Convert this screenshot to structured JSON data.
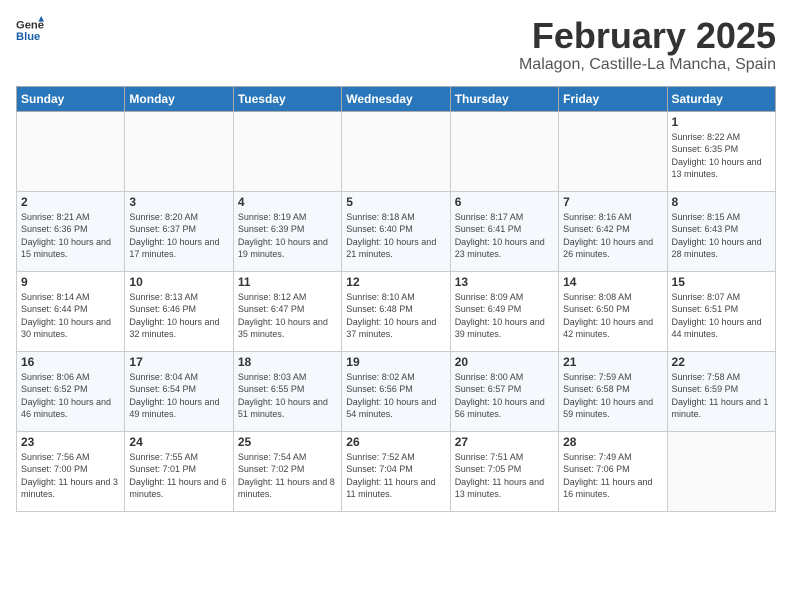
{
  "header": {
    "logo_line1": "General",
    "logo_line2": "Blue",
    "month_title": "February 2025",
    "location": "Malagon, Castille-La Mancha, Spain"
  },
  "weekdays": [
    "Sunday",
    "Monday",
    "Tuesday",
    "Wednesday",
    "Thursday",
    "Friday",
    "Saturday"
  ],
  "weeks": [
    [
      {
        "day": "",
        "info": ""
      },
      {
        "day": "",
        "info": ""
      },
      {
        "day": "",
        "info": ""
      },
      {
        "day": "",
        "info": ""
      },
      {
        "day": "",
        "info": ""
      },
      {
        "day": "",
        "info": ""
      },
      {
        "day": "1",
        "info": "Sunrise: 8:22 AM\nSunset: 6:35 PM\nDaylight: 10 hours and 13 minutes."
      }
    ],
    [
      {
        "day": "2",
        "info": "Sunrise: 8:21 AM\nSunset: 6:36 PM\nDaylight: 10 hours and 15 minutes."
      },
      {
        "day": "3",
        "info": "Sunrise: 8:20 AM\nSunset: 6:37 PM\nDaylight: 10 hours and 17 minutes."
      },
      {
        "day": "4",
        "info": "Sunrise: 8:19 AM\nSunset: 6:39 PM\nDaylight: 10 hours and 19 minutes."
      },
      {
        "day": "5",
        "info": "Sunrise: 8:18 AM\nSunset: 6:40 PM\nDaylight: 10 hours and 21 minutes."
      },
      {
        "day": "6",
        "info": "Sunrise: 8:17 AM\nSunset: 6:41 PM\nDaylight: 10 hours and 23 minutes."
      },
      {
        "day": "7",
        "info": "Sunrise: 8:16 AM\nSunset: 6:42 PM\nDaylight: 10 hours and 26 minutes."
      },
      {
        "day": "8",
        "info": "Sunrise: 8:15 AM\nSunset: 6:43 PM\nDaylight: 10 hours and 28 minutes."
      }
    ],
    [
      {
        "day": "9",
        "info": "Sunrise: 8:14 AM\nSunset: 6:44 PM\nDaylight: 10 hours and 30 minutes."
      },
      {
        "day": "10",
        "info": "Sunrise: 8:13 AM\nSunset: 6:46 PM\nDaylight: 10 hours and 32 minutes."
      },
      {
        "day": "11",
        "info": "Sunrise: 8:12 AM\nSunset: 6:47 PM\nDaylight: 10 hours and 35 minutes."
      },
      {
        "day": "12",
        "info": "Sunrise: 8:10 AM\nSunset: 6:48 PM\nDaylight: 10 hours and 37 minutes."
      },
      {
        "day": "13",
        "info": "Sunrise: 8:09 AM\nSunset: 6:49 PM\nDaylight: 10 hours and 39 minutes."
      },
      {
        "day": "14",
        "info": "Sunrise: 8:08 AM\nSunset: 6:50 PM\nDaylight: 10 hours and 42 minutes."
      },
      {
        "day": "15",
        "info": "Sunrise: 8:07 AM\nSunset: 6:51 PM\nDaylight: 10 hours and 44 minutes."
      }
    ],
    [
      {
        "day": "16",
        "info": "Sunrise: 8:06 AM\nSunset: 6:52 PM\nDaylight: 10 hours and 46 minutes."
      },
      {
        "day": "17",
        "info": "Sunrise: 8:04 AM\nSunset: 6:54 PM\nDaylight: 10 hours and 49 minutes."
      },
      {
        "day": "18",
        "info": "Sunrise: 8:03 AM\nSunset: 6:55 PM\nDaylight: 10 hours and 51 minutes."
      },
      {
        "day": "19",
        "info": "Sunrise: 8:02 AM\nSunset: 6:56 PM\nDaylight: 10 hours and 54 minutes."
      },
      {
        "day": "20",
        "info": "Sunrise: 8:00 AM\nSunset: 6:57 PM\nDaylight: 10 hours and 56 minutes."
      },
      {
        "day": "21",
        "info": "Sunrise: 7:59 AM\nSunset: 6:58 PM\nDaylight: 10 hours and 59 minutes."
      },
      {
        "day": "22",
        "info": "Sunrise: 7:58 AM\nSunset: 6:59 PM\nDaylight: 11 hours and 1 minute."
      }
    ],
    [
      {
        "day": "23",
        "info": "Sunrise: 7:56 AM\nSunset: 7:00 PM\nDaylight: 11 hours and 3 minutes."
      },
      {
        "day": "24",
        "info": "Sunrise: 7:55 AM\nSunset: 7:01 PM\nDaylight: 11 hours and 6 minutes."
      },
      {
        "day": "25",
        "info": "Sunrise: 7:54 AM\nSunset: 7:02 PM\nDaylight: 11 hours and 8 minutes."
      },
      {
        "day": "26",
        "info": "Sunrise: 7:52 AM\nSunset: 7:04 PM\nDaylight: 11 hours and 11 minutes."
      },
      {
        "day": "27",
        "info": "Sunrise: 7:51 AM\nSunset: 7:05 PM\nDaylight: 11 hours and 13 minutes."
      },
      {
        "day": "28",
        "info": "Sunrise: 7:49 AM\nSunset: 7:06 PM\nDaylight: 11 hours and 16 minutes."
      },
      {
        "day": "",
        "info": ""
      }
    ]
  ]
}
